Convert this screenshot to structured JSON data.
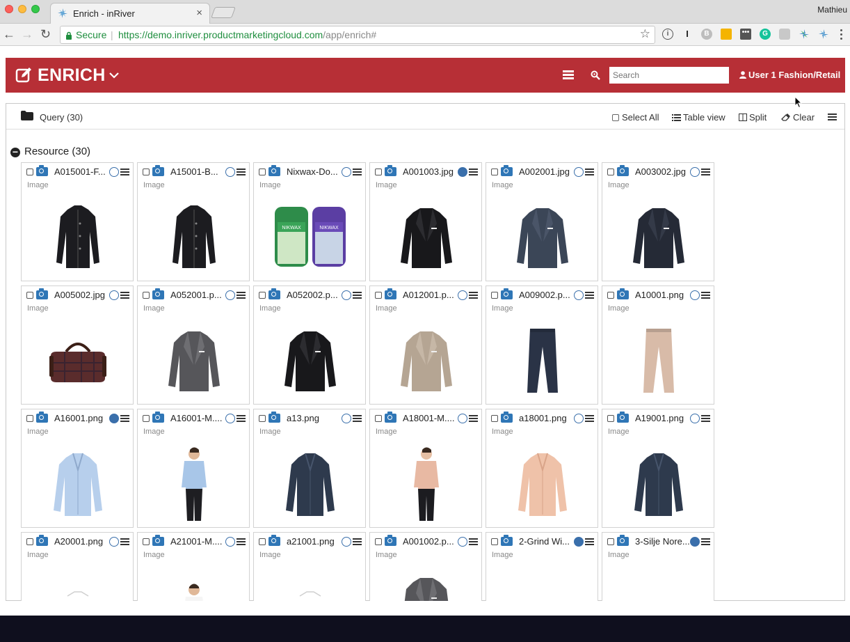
{
  "browser": {
    "tab_title": "Enrich - inRiver",
    "tab_close": "×",
    "user_name": "Mathieu",
    "secure_label": "Secure",
    "url_base": "https://demo.inriver.productmarketingcloud.com",
    "url_path": "/app/enrich#",
    "back_glyph": "←",
    "forward_glyph": "→",
    "reload_glyph": "↻",
    "star_glyph": "☆"
  },
  "header": {
    "title": "ENRICH",
    "search_placeholder": "Search",
    "user_label": "User 1 Fashion/Retail",
    "brand_color": "#b72f36"
  },
  "toolbar": {
    "query_label": "Query (30)",
    "select_all": "Select All",
    "table_view": "Table view",
    "split": "Split",
    "clear": "Clear"
  },
  "group": {
    "label": "Resource (30)",
    "collapse_glyph": "−"
  },
  "cards": [
    {
      "name": "A015001-F...",
      "type": "Image",
      "selected": false,
      "thumb": "black-jacket"
    },
    {
      "name": "A15001-B...",
      "type": "Image",
      "selected": false,
      "thumb": "black-jacket"
    },
    {
      "name": "Nixwax-Do...",
      "type": "Image",
      "selected": false,
      "thumb": "nikwax"
    },
    {
      "name": "A001003.jpg",
      "type": "Image",
      "selected": true,
      "thumb": "blazer-black"
    },
    {
      "name": "A002001.jpg",
      "type": "Image",
      "selected": false,
      "thumb": "blazer-navy"
    },
    {
      "name": "A003002.jpg",
      "type": "Image",
      "selected": false,
      "thumb": "blazer-dark"
    },
    {
      "name": "A005002.jpg",
      "type": "Image",
      "selected": false,
      "thumb": "bag"
    },
    {
      "name": "A052001.p...",
      "type": "Image",
      "selected": false,
      "thumb": "blazer-grey"
    },
    {
      "name": "A052002.p...",
      "type": "Image",
      "selected": false,
      "thumb": "blazer-black"
    },
    {
      "name": "A012001.p...",
      "type": "Image",
      "selected": false,
      "thumb": "blazer-beige"
    },
    {
      "name": "A009002.p...",
      "type": "Image",
      "selected": false,
      "thumb": "pants-navy"
    },
    {
      "name": "A10001.png",
      "type": "Image",
      "selected": false,
      "thumb": "pants-beige"
    },
    {
      "name": "A16001.png",
      "type": "Image",
      "selected": true,
      "thumb": "shirt-blue"
    },
    {
      "name": "A16001-M....",
      "type": "Image",
      "selected": false,
      "thumb": "man-blue"
    },
    {
      "name": "a13.png",
      "type": "Image",
      "selected": false,
      "thumb": "shirt-navy"
    },
    {
      "name": "A18001-M....",
      "type": "Image",
      "selected": false,
      "thumb": "woman-pink"
    },
    {
      "name": "a18001.png",
      "type": "Image",
      "selected": false,
      "thumb": "shirt-pink"
    },
    {
      "name": "A19001.png",
      "type": "Image",
      "selected": false,
      "thumb": "shirt-navy"
    },
    {
      "name": "A20001.png",
      "type": "Image",
      "selected": false,
      "thumb": "white-faint"
    },
    {
      "name": "A21001-M....",
      "type": "Image",
      "selected": false,
      "thumb": "man-white"
    },
    {
      "name": "a21001.png",
      "type": "Image",
      "selected": false,
      "thumb": "white-faint"
    },
    {
      "name": "A001002.p...",
      "type": "Image",
      "selected": false,
      "thumb": "blazer-grey"
    },
    {
      "name": "2-Grind Wi...",
      "type": "Image",
      "selected": true,
      "thumb": "photo-street"
    },
    {
      "name": "3-Silje Nore...",
      "type": "Image",
      "selected": true,
      "thumb": "photo-person"
    }
  ]
}
